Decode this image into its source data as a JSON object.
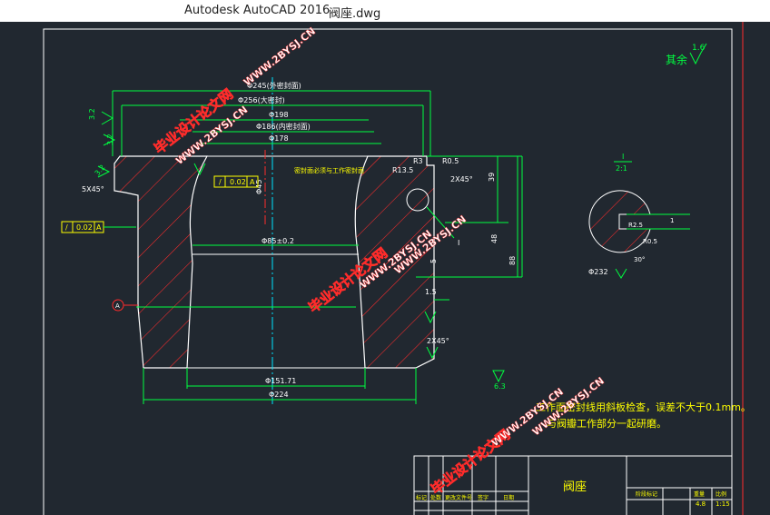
{
  "window": {
    "app_title": "Autodesk AutoCAD 2016",
    "file_name": "阀座.dwg"
  },
  "drawing": {
    "roughness_other_label": "其余",
    "roughness_other_value": "1.6",
    "roughness_values": [
      "3.2",
      "3.2",
      "3.2",
      "1.6",
      "0.8",
      "0.8",
      "6.3"
    ],
    "top_dims": [
      "Φ245(外密封面)",
      "Φ256(大密封)",
      "Φ198",
      "Φ186(内密封面)",
      "Φ178"
    ],
    "side_dims": [
      "R13.5",
      "R3",
      "R0.5",
      "2X45°",
      "39",
      "48",
      "88",
      "5",
      "1.5",
      "2X45°"
    ],
    "center_dims": [
      "Φ85±0.2",
      "Φ151.71",
      "Φ224",
      "Φ45"
    ],
    "chamfer_left": "5X45°",
    "tolerance_1": "0.02",
    "tolerance_2": "0.02",
    "datum": "A",
    "section_note": "密封面必须与工作密封面",
    "detail_label": "I",
    "detail_scale": "2:1",
    "detail_dims": [
      "Φ232",
      "R2.5",
      "1",
      "R0.5",
      "30°"
    ],
    "detail_ref": "I",
    "notes": [
      "工作面密封线用斜板检查，误差不大于0.1mm。",
      "与阀瓣工作部分一起研磨。"
    ],
    "title_block": {
      "part_name": "阀座",
      "material_code": "4.8",
      "scale": "1:15",
      "row_labels": [
        "标记",
        "处数",
        "更改文件号",
        "签字",
        "日期"
      ],
      "header_labels": [
        "阶段标记",
        "重量",
        "比例"
      ]
    },
    "watermarks": [
      "毕业设计论文网",
      "WWW.2BYSJ.CN"
    ],
    "colors": {
      "background": "#212830",
      "outline": "#ffffff",
      "hatch": "#ff2b2b",
      "dimension": "#00ff40",
      "center": "#00e5ff",
      "text_yellow": "#ffff00"
    }
  }
}
